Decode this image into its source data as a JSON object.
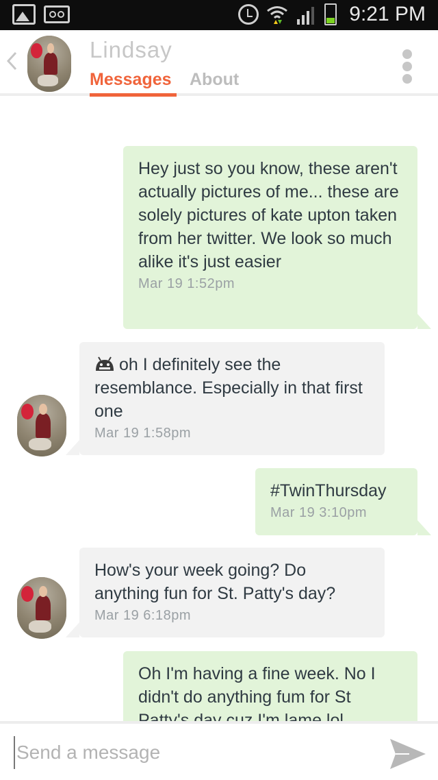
{
  "status_bar": {
    "time": "9:21 PM",
    "icons": [
      "gallery-icon",
      "voicemail-icon",
      "alarm-icon",
      "wifi-icon",
      "signal-icon",
      "battery-icon"
    ],
    "battery_color": "#7cd321"
  },
  "header": {
    "contact_name": "Lindsay",
    "tabs": [
      {
        "label": "Messages",
        "active": true
      },
      {
        "label": "About",
        "active": false
      }
    ],
    "accent_color": "#f0643b"
  },
  "messages": [
    {
      "direction": "sent",
      "text": "Hey just so you know, these aren't actually pictures of me... these are solely pictures of kate upton taken from her twitter. We look so much alike it's just easier",
      "timestamp": "Mar 19  1:52pm"
    },
    {
      "direction": "received",
      "icon": "android-emoji-icon",
      "text": "oh I definitely see the resemblance. Especially in that first one",
      "timestamp": "Mar 19  1:58pm"
    },
    {
      "direction": "sent",
      "text": "#TwinThursday",
      "timestamp": "Mar 19  3:10pm"
    },
    {
      "direction": "received",
      "text": "How's your week going? Do anything fun for St. Patty's day?",
      "timestamp": "Mar 19  6:18pm"
    },
    {
      "direction": "sent",
      "text": "Oh I'm having a fine week. No I didn't do anything fum for St Patty's day cuz I'm lame lol",
      "timestamp": ""
    }
  ],
  "composer": {
    "placeholder": "Send a message",
    "value": ""
  },
  "colors": {
    "sent_bubble": "#e2f4d9",
    "received_bubble": "#f2f2f2"
  }
}
